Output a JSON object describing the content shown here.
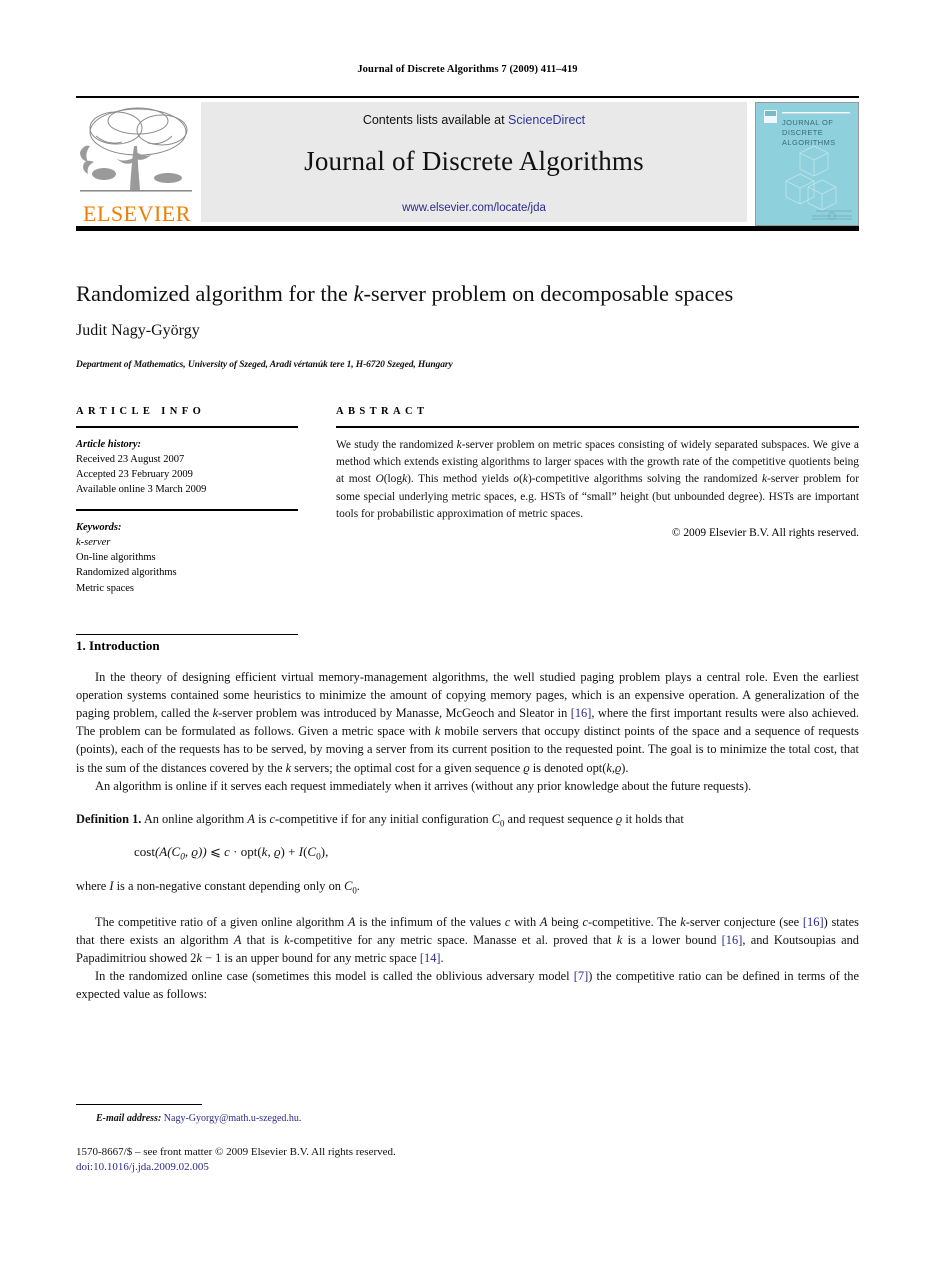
{
  "running_head": "Journal of Discrete Algorithms 7 (2009) 411–419",
  "masthead": {
    "contents_prefix": "Contents lists available at ",
    "sciencedirect": "ScienceDirect",
    "journal_name": "Journal of Discrete Algorithms",
    "journal_url": "www.elsevier.com/locate/jda",
    "publisher_wordmark": "ELSEVIER",
    "cover_title_lines": [
      "JOURNAL OF",
      "DISCRETE",
      "ALGORITHMS"
    ],
    "link_color": "#333399",
    "url_color": "#2b2b8c",
    "wordmark_color": "#f07d00",
    "cover_bg_color": "#8fd0dd",
    "contents_bg_color": "#e9e9e9"
  },
  "article": {
    "title_pre": "Randomized algorithm for the ",
    "title_italic": "k",
    "title_post": "-server problem on decomposable spaces",
    "author": "Judit Nagy-György",
    "affiliation": "Department of Mathematics, University of Szeged, Aradi vértanúk tere 1, H-6720 Szeged, Hungary"
  },
  "info": {
    "heading": "ARTICLE INFO",
    "history_label": "Article history:",
    "history": [
      "Received 23 August 2007",
      "Accepted 23 February 2009",
      "Available online 3 March 2009"
    ],
    "keywords_label": "Keywords:",
    "keywords": [
      "k-server",
      "On-line algorithms",
      "Randomized algorithms",
      "Metric spaces"
    ]
  },
  "abstract": {
    "heading": "ABSTRACT",
    "p1_a": "We study the randomized ",
    "p1_k": "k",
    "p1_b": "-server problem on metric spaces consisting of widely separated subspaces. We give a method which extends existing algorithms to larger spaces with the growth rate of the competitive quotients being at most ",
    "p1_O": "O",
    "p1_c": "(log",
    "p1_k2": "k",
    "p1_d": "). This method yields ",
    "p1_o": "o",
    "p1_e": "(",
    "p1_k3": "k",
    "p1_f": ")-competitive algorithms solving the randomized ",
    "p1_k4": "k",
    "p1_g": "-server problem for some special underlying metric spaces, e.g. HSTs of “small” height (but unbounded degree). HSTs are important tools for probabilistic approximation of metric spaces.",
    "copyright": "© 2009 Elsevier B.V. All rights reserved."
  },
  "body": {
    "section_number_title": "1. Introduction",
    "para1_a": "In the theory of designing efficient virtual memory-management algorithms, the well studied paging problem plays a central role. Even the earliest operation systems contained some heuristics to minimize the amount of copying memory pages, which is an expensive operation. A generalization of the paging problem, called the ",
    "para1_k": "k",
    "para1_b": "-server problem was introduced by Manasse, McGeoch and Sleator in ",
    "para1_ref16": "[16]",
    "para1_c": ", where the first important results were also achieved. The problem can be formulated as follows. Given a metric space with ",
    "para1_k2": "k",
    "para1_d": " mobile servers that occupy distinct points of the space and a sequence of requests (points), each of the requests has to be served, by moving a server from its current position to the requested point. The goal is to minimize the total cost, that is the sum of the distances covered by the ",
    "para1_k3": "k",
    "para1_e": " servers; the optimal cost for a given sequence ",
    "para1_rho": "ϱ",
    "para1_f": " is denoted opt(",
    "para1_k4": "k",
    "para1_g": ",",
    "para1_rho2": "ϱ",
    "para1_h": ").",
    "para2": "An algorithm is online if it serves each request immediately when it arrives (without any prior knowledge about the future requests).",
    "definition_label": "Definition 1.",
    "definition_a": " An online algorithm ",
    "definition_A": "A",
    "definition_b": " is ",
    "definition_c": "c",
    "definition_d": "-competitive if for any initial configuration ",
    "definition_C0": "C",
    "definition_C0sub": "0",
    "definition_e": " and request sequence ",
    "definition_rho": "ϱ",
    "definition_f": " it holds that",
    "equation": "cost(A(C0, ϱ)) ⩽ c · opt(k, ϱ) + I(C0),",
    "where_a": "where ",
    "where_I": "I",
    "where_b": " is a non-negative constant depending only on ",
    "where_C0": "C",
    "where_C0sub": "0",
    "where_c": ".",
    "para3_a": "The competitive ratio of a given online algorithm ",
    "para3_A": "A",
    "para3_b": " is the infimum of the values ",
    "para3_c": "c",
    "para3_d": " with ",
    "para3_A2": "A",
    "para3_e": " being ",
    "para3_c2": "c",
    "para3_f": "-competitive. The ",
    "para3_k": "k",
    "para3_g": "-server conjecture (see ",
    "para3_ref16": "[16]",
    "para3_h": ") states that there exists an algorithm ",
    "para3_A3": "A",
    "para3_i": " that is ",
    "para3_k2": "k",
    "para3_j": "-competitive for any metric space. Manasse et al. proved that ",
    "para3_k3": "k",
    "para3_l": " is a lower bound ",
    "para3_ref16b": "[16]",
    "para3_m": ", and Koutsoupias and Papadimitriou showed 2",
    "para3_k4": "k",
    "para3_n": " − 1 is an upper bound for any metric space ",
    "para3_ref14": "[14]",
    "para3_o": ".",
    "para4_a": "In the randomized online case (sometimes this model is called the oblivious adversary model ",
    "para4_ref7": "[7]",
    "para4_b": ") the competitive ratio can be defined in terms of the expected value as follows:"
  },
  "footer": {
    "email_label": "E-mail address:",
    "email_address": "Nagy-Gyorgy@math.u-szeged.hu",
    "email_suffix": ".",
    "issn_line": "1570-8667/$ – see front matter © 2009 Elsevier B.V. All rights reserved.",
    "doi_line": "doi:10.1016/j.jda.2009.02.005"
  }
}
